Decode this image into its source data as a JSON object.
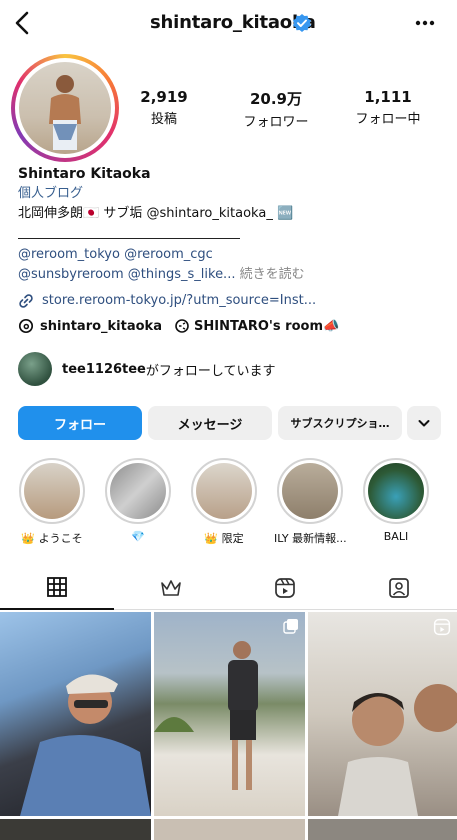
{
  "header": {
    "username": "shintaro_kitaoka",
    "icons": [
      "back-icon",
      "verified-badge-icon",
      "more-icon"
    ]
  },
  "stats": [
    {
      "value": "2,919",
      "label": "投稿"
    },
    {
      "value": "20.9万",
      "label": "フォロワー"
    },
    {
      "value": "1,111",
      "label": "フォロー中"
    }
  ],
  "bio": {
    "name": "Shintaro Kitaoka",
    "category": "個人ブログ",
    "line1": "北岡伸多朗🇯🇵 サブ垢 @shintaro_kitaoka_ 🆕",
    "tags_line1": "@reroom_tokyo @reroom_cgc",
    "tags_line2": "@sunsbyreroom @things_s_like...",
    "more": "続きを読む",
    "link": "store.reroom-tokyo.jp/?utm_source=Inst..."
  },
  "threads": {
    "handle": "shintaro_kitaoka",
    "room": "SHINTARO's room📣"
  },
  "followed_by": {
    "user": "tee1126tee",
    "text": "がフォローしています"
  },
  "buttons": {
    "follow": "フォロー",
    "message": "メッセージ",
    "subscription": "サブスクリプショ…"
  },
  "highlights": [
    {
      "label": "👑 ようこそ"
    },
    {
      "label": "💎"
    },
    {
      "label": "👑 限定"
    },
    {
      "label": "ILY 最新情報..."
    },
    {
      "label": "BALI"
    }
  ],
  "tabs": [
    "grid-icon",
    "crown-icon",
    "reels-icon",
    "tagged-icon"
  ],
  "colors": {
    "accent": "#2090ec",
    "link": "#2f4f7f",
    "verified": "#3797f0"
  }
}
